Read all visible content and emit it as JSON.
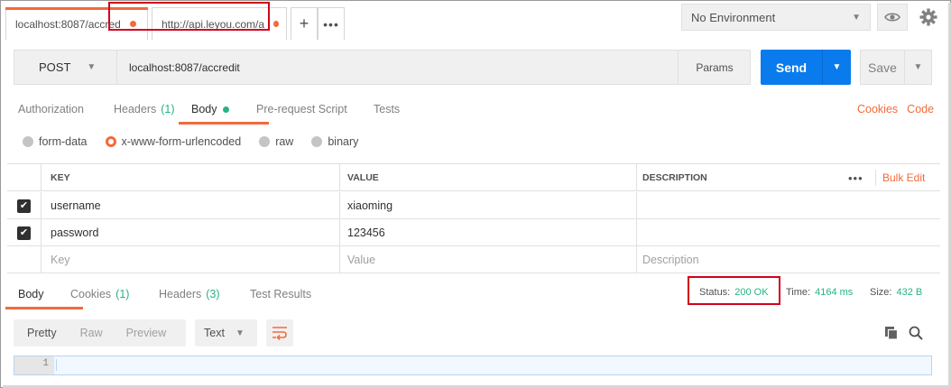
{
  "tabs": [
    {
      "label": "localhost:8087/accred",
      "unsaved": true
    },
    {
      "label": "http://api.leyou.com/a",
      "unsaved": true
    }
  ],
  "tab_new_label": "+",
  "tab_more_label": "•••",
  "environment": {
    "selected": "No Environment"
  },
  "request": {
    "method": "POST",
    "url": "localhost:8087/accredit",
    "params_label": "Params",
    "send_label": "Send",
    "save_label": "Save"
  },
  "request_tabs": [
    {
      "label": "Authorization",
      "count": ""
    },
    {
      "label": "Headers",
      "count": "(1)"
    },
    {
      "label": "Body",
      "count": ""
    },
    {
      "label": "Pre-request Script",
      "count": ""
    },
    {
      "label": "Tests",
      "count": ""
    }
  ],
  "request_links": {
    "cookies": "Cookies",
    "code": "Code"
  },
  "body_types": [
    {
      "label": "form-data",
      "selected": false
    },
    {
      "label": "x-www-form-urlencoded",
      "selected": true
    },
    {
      "label": "raw",
      "selected": false
    },
    {
      "label": "binary",
      "selected": false
    }
  ],
  "params_table": {
    "headers": {
      "key": "KEY",
      "value": "VALUE",
      "description": "DESCRIPTION"
    },
    "more_label": "•••",
    "bulk_edit_label": "Bulk Edit",
    "rows": [
      {
        "checked": true,
        "key": "username",
        "value": "xiaoming",
        "description": ""
      },
      {
        "checked": true,
        "key": "password",
        "value": "123456",
        "description": ""
      }
    ],
    "placeholders": {
      "key": "Key",
      "value": "Value",
      "description": "Description"
    }
  },
  "response_tabs": [
    {
      "label": "Body",
      "count": ""
    },
    {
      "label": "Cookies",
      "count": "(1)"
    },
    {
      "label": "Headers",
      "count": "(3)"
    },
    {
      "label": "Test Results",
      "count": ""
    }
  ],
  "response_stats": {
    "status_label": "Status:",
    "status_value": "200 OK",
    "time_label": "Time:",
    "time_value": "4164 ms",
    "size_label": "Size:",
    "size_value": "432 B"
  },
  "response_view": {
    "modes": [
      "Pretty",
      "Raw",
      "Preview"
    ],
    "format": "Text"
  },
  "editor": {
    "line_number": "1"
  },
  "colors": {
    "accent": "#f26b3a",
    "send": "#097bed",
    "success": "#26b47f",
    "highlight": "#d0021b"
  },
  "icons": [
    "plus-icon",
    "more-icon",
    "eye-icon",
    "gear-icon",
    "chevron-down-icon",
    "check-icon",
    "wrap-icon",
    "copy-icon",
    "search-icon"
  ]
}
